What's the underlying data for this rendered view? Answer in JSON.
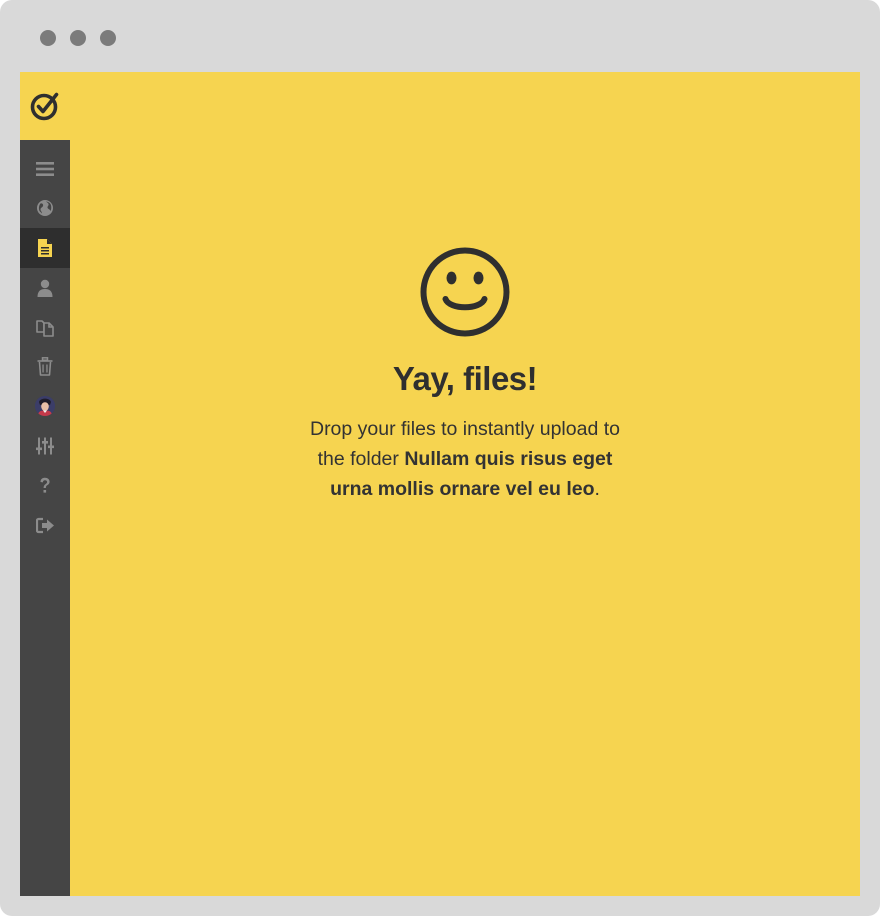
{
  "window": {
    "traffic_lights": [
      "close",
      "minimize",
      "maximize"
    ]
  },
  "colors": {
    "background": "#f6d450",
    "sidebar": "#454545",
    "sidebar_active": "#2e2e2e",
    "icon_muted": "#8c8c8c",
    "accent": "#f6d450",
    "text": "#2f2f2f",
    "window_frame": "#d9d9d9"
  },
  "logo": {
    "icon": "check-circle-icon"
  },
  "sidebar": {
    "items": [
      {
        "icon": "menu-icon",
        "active": false
      },
      {
        "icon": "globe-icon",
        "active": false
      },
      {
        "icon": "file-icon",
        "active": true
      },
      {
        "icon": "user-icon",
        "active": false
      },
      {
        "icon": "copy-icon",
        "active": false
      },
      {
        "icon": "trash-icon",
        "active": false
      },
      {
        "icon": "avatar",
        "active": false
      },
      {
        "icon": "sliders-icon",
        "active": false
      },
      {
        "icon": "question-icon",
        "active": false
      },
      {
        "icon": "sign-out-icon",
        "active": false
      }
    ]
  },
  "empty_state": {
    "icon": "smiley-icon",
    "title": "Yay, files!",
    "line_prefix": "Drop your files to instantly upload to the folder",
    "folder_name": "Nullam quis risus eget urna mollis ornare vel eu leo",
    "line_suffix": "."
  }
}
